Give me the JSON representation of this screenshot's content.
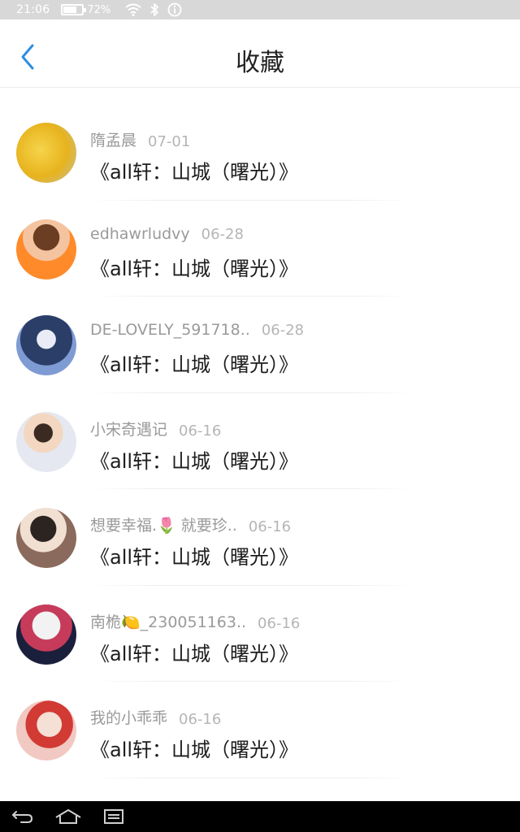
{
  "status_bar": {
    "time": "21:06",
    "battery_percent": "72%",
    "battery_level": 0.72,
    "icons": [
      "battery-icon",
      "wifi-icon",
      "bluetooth-icon",
      "info-icon"
    ]
  },
  "header": {
    "title": "收藏",
    "back_icon": "back-chevron-icon",
    "accent_color": "#2a8fe4"
  },
  "list": {
    "items": [
      {
        "name": "隋孟晨",
        "date": "07-01",
        "title": "《all轩：山城（曙光）》"
      },
      {
        "name": "edhawrludvy",
        "date": "06-28",
        "title": "《all轩：山城（曙光）》"
      },
      {
        "name": "DE-LOVELY_591718..",
        "date": "06-28",
        "title": "《all轩：山城（曙光）》"
      },
      {
        "name": "小宋奇遇记",
        "date": "06-16",
        "title": "《all轩：山城（曙光）》"
      },
      {
        "name": "想要幸福.🌷 就要珍..",
        "date": "06-16",
        "title": "《all轩：山城（曙光）》"
      },
      {
        "name": "南桅🍋_230051163..",
        "date": "06-16",
        "title": "《all轩：山城（曙光）》"
      },
      {
        "name": "我的小乖乖",
        "date": "06-16",
        "title": "《all轩：山城（曙光）》"
      }
    ]
  },
  "nav_bar": {
    "icons": [
      "back-icon",
      "home-icon",
      "recent-apps-icon"
    ]
  }
}
